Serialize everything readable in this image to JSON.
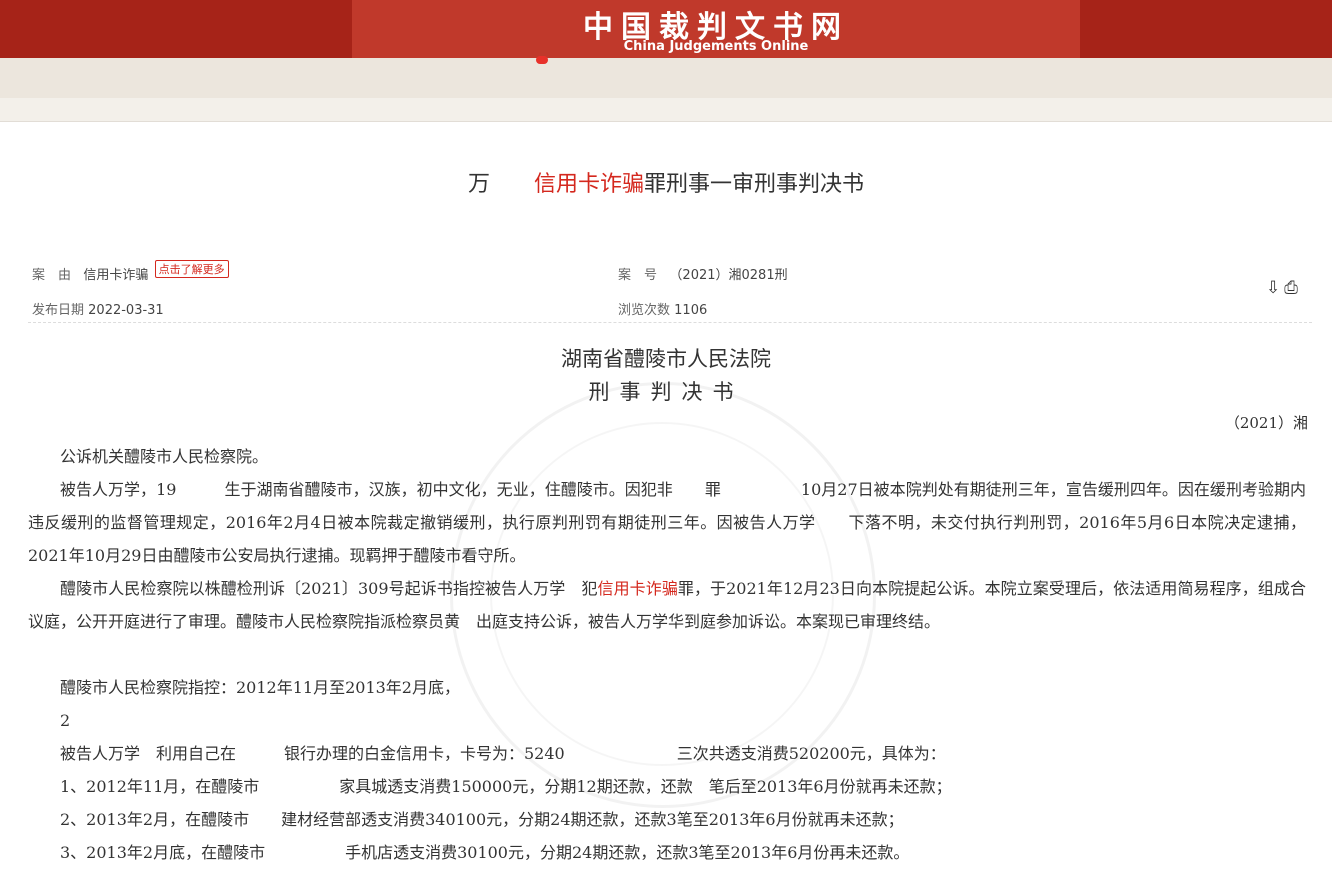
{
  "site": {
    "name_cn": "中国裁判文书网",
    "name_en": "China Judgements Online"
  },
  "doc": {
    "title_pre": "万",
    "title_hl": "信用卡诈骗",
    "title_post": "罪刑事一审刑事判决书",
    "cause_label": "案　由",
    "cause_value": "信用卡诈骗",
    "more_tag": "点击了解更多",
    "case_no_label": "案　号",
    "case_no_value": "（2021）湘0281刑",
    "date_label": "发布日期",
    "date_value": "2022-03-31",
    "views_label": "浏览次数",
    "views_value": "1106",
    "court": "湖南省醴陵市人民法院",
    "doctype": "刑事判决书",
    "doc_no": "（2021）湘",
    "p1": "公诉机关醴陵市人民检察院。",
    "p2": "被告人万学，19　　　生于湖南省醴陵市，汉族，初中文化，无业，住醴陵市。因犯非　　罪　　　　　10月27日被本院判处有期徒刑三年，宣告缓刑四年。因在缓刑考验期内违反缓刑的监督管理规定，2016年2月4日被本院裁定撤销缓刑，执行原判刑罚有期徒刑三年。因被告人万学　　下落不明，未交付执行判刑罚，2016年5月6日本院决定逮捕，2021年10月29日由醴陵市公安局执行逮捕。现羁押于醴陵市看守所。",
    "p3_pre": "醴陵市人民检察院以株醴检刑诉〔2021〕309号起诉书指控被告人万学　犯",
    "p3_hl": "信用卡诈骗",
    "p3_post": "罪，于2021年12月23日向本院提起公诉。本院立案受理后，依法适用简易程序，组成合议庭，公开开庭进行了审理。醴陵市人民检察院指派检察员黄　出庭支持公诉，被告人万学华到庭参加诉讼。本案现已审理终结。",
    "p4": "醴陵市人民检察院指控：2012年11月至2013年2月底，",
    "p5": "2",
    "p6": "被告人万学　利用自己在　　　银行办理的白金信用卡，卡号为：5240　　　　　　　三次共透支消费520200元，具体为：",
    "p7": "1、2012年11月，在醴陵市　　　　　家具城透支消费150000元，分期12期还款，还款　笔后至2013年6月份就再未还款；",
    "p8": "2、2013年2月，在醴陵市　　建材经营部透支消费340100元，分期24期还款，还款3笔至2013年6月份就再未还款；",
    "p9": "3、2013年2月底，在醴陵市　　　　　手机店透支消费30100元，分期24期还款，还款3笔至2013年6月份再未还款。"
  },
  "icons": [
    "download-icon",
    "print-icon"
  ],
  "colors": {
    "header_dark": "#a62318",
    "header": "#c0392b",
    "highlight": "#d4281e"
  }
}
